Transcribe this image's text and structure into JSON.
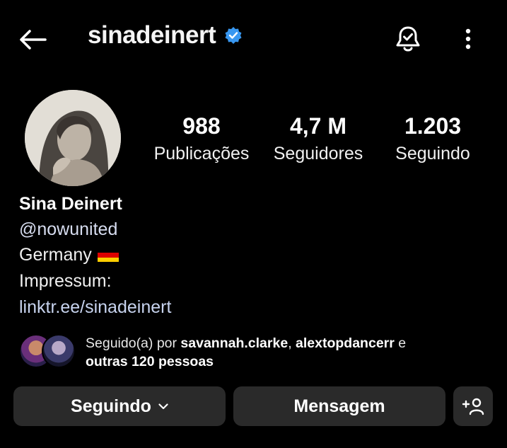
{
  "header": {
    "username": "sinadeinert"
  },
  "stats": [
    {
      "value": "988",
      "label": "Publicações"
    },
    {
      "value": "4,7 M",
      "label": "Seguidores"
    },
    {
      "value": "1.203",
      "label": "Seguindo"
    }
  ],
  "bio": {
    "name": "Sina Deinert",
    "handle": "@nowunited",
    "location": "Germany",
    "impressum": "Impressum:",
    "link": "linktr.ee/sinadeinert"
  },
  "followed_by": {
    "prefix": "Seguido(a) por",
    "user1": "savannah.clarke",
    "separator": ",",
    "user2": "alextopdancerr",
    "conj": "e",
    "others": "outras 120 pessoas"
  },
  "actions": {
    "following_label": "Seguindo",
    "message_label": "Mensagem"
  },
  "colors": {
    "background": "#000000",
    "button": "#2a2a2a",
    "verified": "#3897f0"
  },
  "icons": [
    "back-arrow-icon",
    "verified-badge-icon",
    "bell-check-icon",
    "more-vertical-icon",
    "chevron-down-icon",
    "add-person-icon"
  ]
}
